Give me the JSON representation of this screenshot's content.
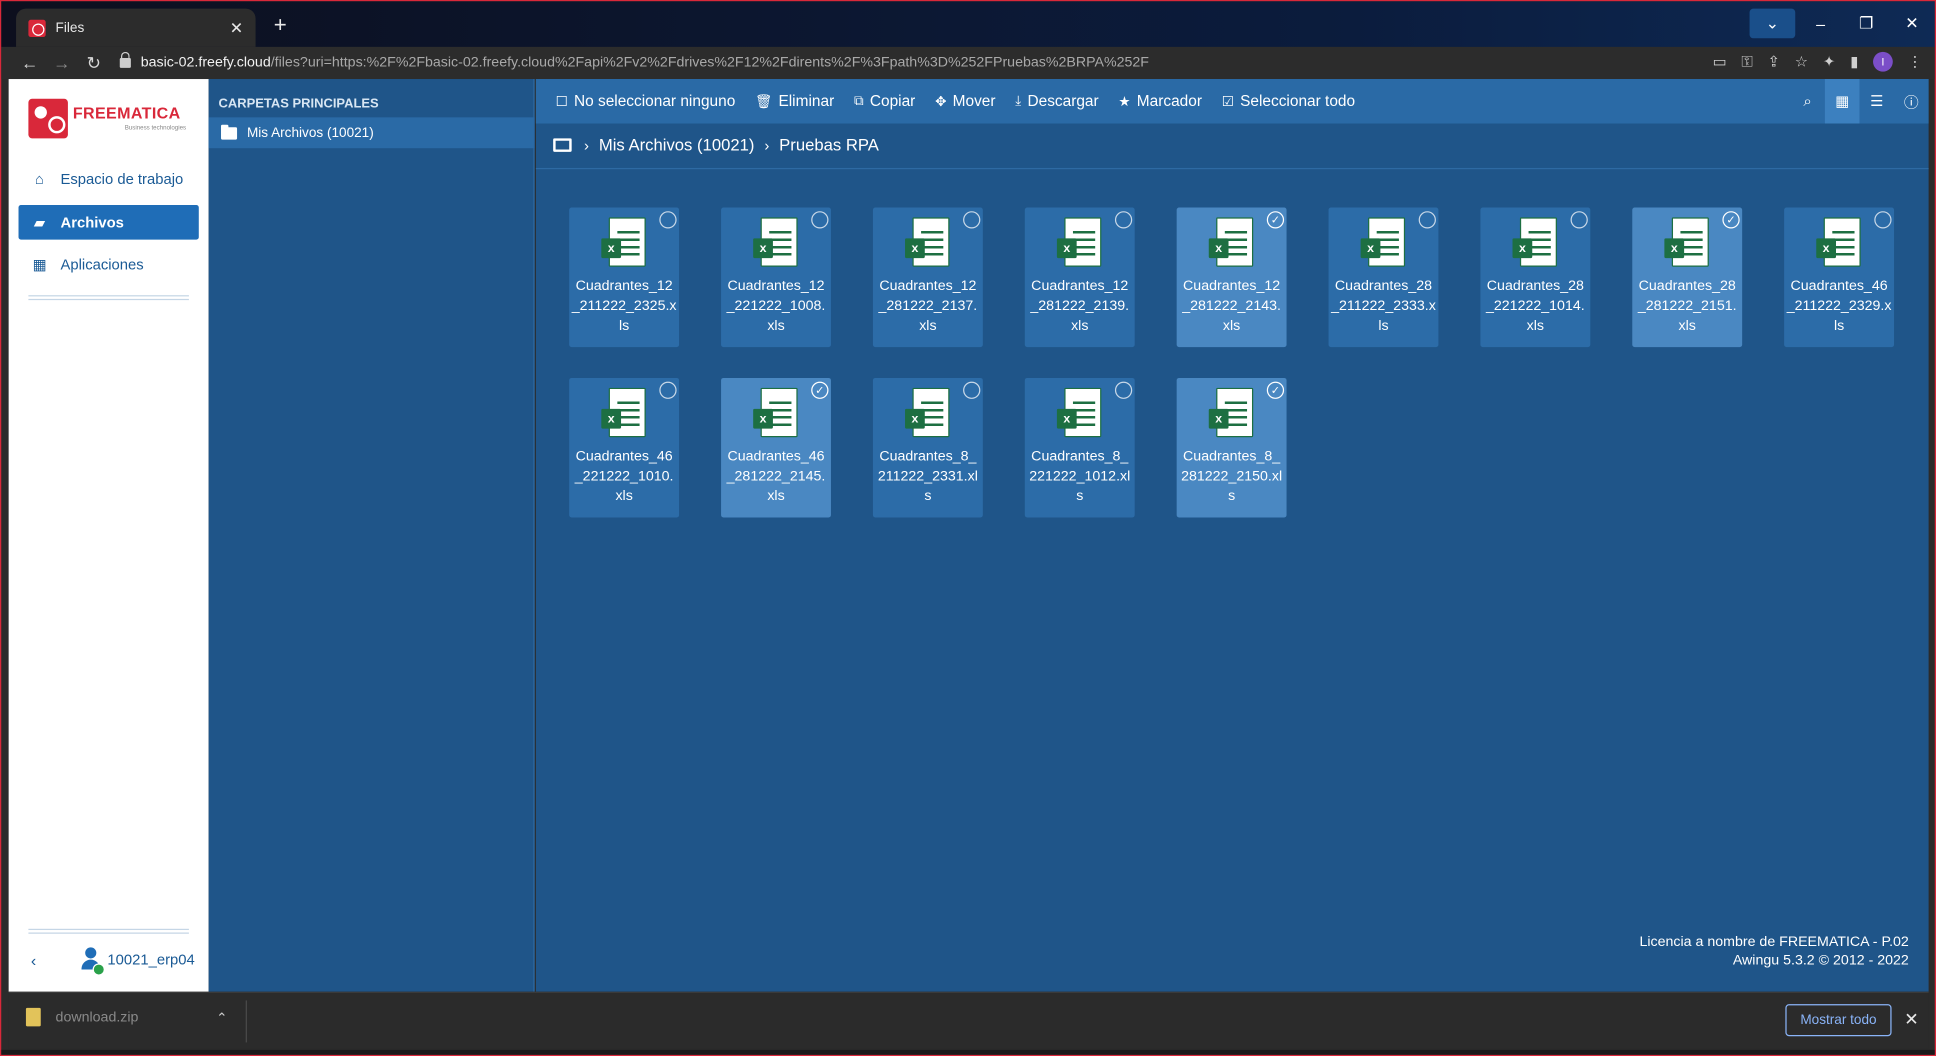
{
  "browser": {
    "tab_title": "Files",
    "url_host": "basic-02.freefy.cloud",
    "url_path": "/files?uri=https:%2F%2Fbasic-02.freefy.cloud%2Fapi%2Fv2%2Fdrives%2F12%2Fdirents%2F%3Fpath%3D%252FPruebas%2BRPA%252F",
    "profile_initial": "I"
  },
  "sidebar": {
    "logo_text": "FREEMATICA",
    "logo_sub": "Business technologies",
    "items": [
      {
        "label": "Espacio de trabajo",
        "icon": "home-icon"
      },
      {
        "label": "Archivos",
        "icon": "folder-open-icon"
      },
      {
        "label": "Aplicaciones",
        "icon": "apps-grid-icon"
      }
    ],
    "user": "10021_erp04"
  },
  "tree": {
    "heading": "CARPETAS PRINCIPALES",
    "root": "Mis Archivos (10021)"
  },
  "toolbar": {
    "deselect": "No seleccionar ninguno",
    "delete": "Eliminar",
    "copy": "Copiar",
    "move": "Mover",
    "download": "Descargar",
    "bookmark": "Marcador",
    "select_all": "Seleccionar todo"
  },
  "breadcrumb": [
    "Mis Archivos (10021)",
    "Pruebas RPA"
  ],
  "files": [
    {
      "name": "Cuadrantes_12_211222_2325.xls",
      "selected": false
    },
    {
      "name": "Cuadrantes_12_221222_1008.xls",
      "selected": false
    },
    {
      "name": "Cuadrantes_12_281222_2137.xls",
      "selected": false
    },
    {
      "name": "Cuadrantes_12_281222_2139.xls",
      "selected": false
    },
    {
      "name": "Cuadrantes_12_281222_2143.xls",
      "selected": true
    },
    {
      "name": "Cuadrantes_28_211222_2333.xls",
      "selected": false
    },
    {
      "name": "Cuadrantes_28_221222_1014.xls",
      "selected": false
    },
    {
      "name": "Cuadrantes_28_281222_2151.xls",
      "selected": true
    },
    {
      "name": "Cuadrantes_46_211222_2329.xls",
      "selected": false
    },
    {
      "name": "Cuadrantes_46_221222_1010.xls",
      "selected": false
    },
    {
      "name": "Cuadrantes_46_281222_2145.xls",
      "selected": true
    },
    {
      "name": "Cuadrantes_8_211222_2331.xls",
      "selected": false
    },
    {
      "name": "Cuadrantes_8_221222_1012.xls",
      "selected": false
    },
    {
      "name": "Cuadrantes_8_281222_2150.xls",
      "selected": true
    }
  ],
  "license": {
    "line1": "Licencia a nombre de FREEMATICA - P.02",
    "line2": "Awingu 5.3.2 © 2012 - 2022"
  },
  "downloads": {
    "file": "download.zip",
    "show_all": "Mostrar todo"
  },
  "colors": {
    "app_blue": "#1f5589",
    "toolbar_blue": "#2a6aa6",
    "brand_red": "#d9283a",
    "excel_green": "#1d6f42"
  }
}
